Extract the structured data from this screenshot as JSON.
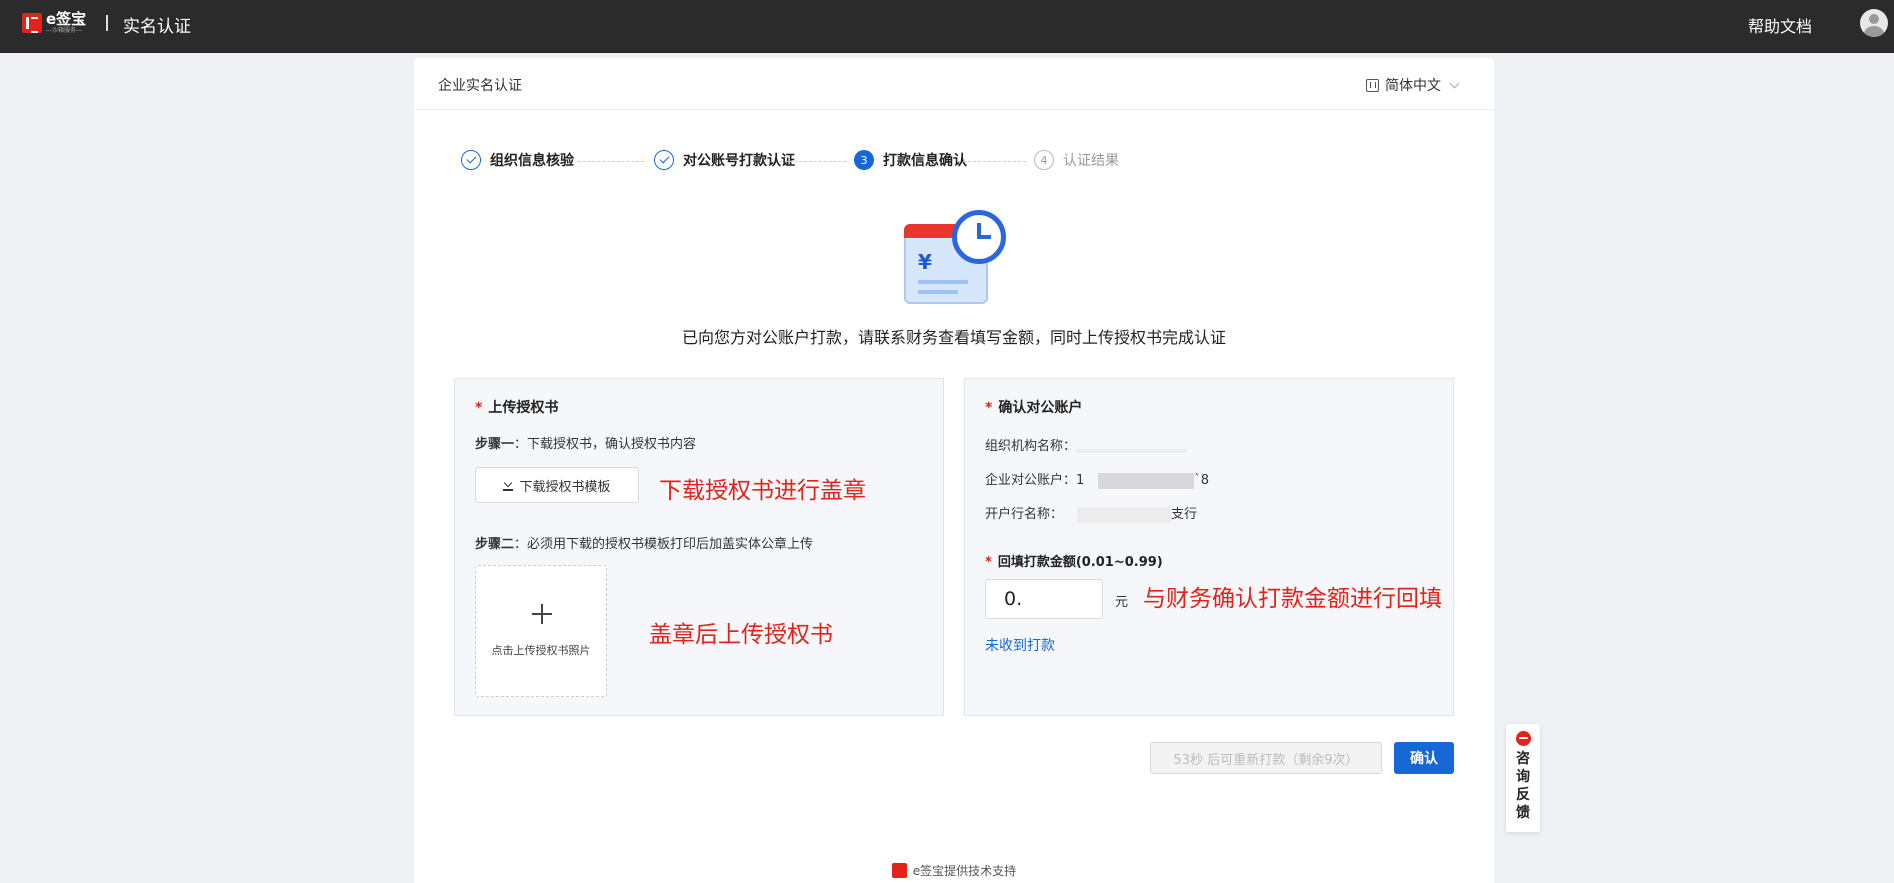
{
  "header": {
    "logo_name": "e签宝",
    "logo_sub": "—沙箱服务—",
    "title": "实名认证",
    "help_label": "帮助文档"
  },
  "card": {
    "title": "企业实名认证",
    "language": "简体中文"
  },
  "steps": [
    {
      "label": "组织信息核验",
      "status": "done"
    },
    {
      "label": "对公账号打款认证",
      "status": "done"
    },
    {
      "label": "打款信息确认",
      "status": "active",
      "number": "3"
    },
    {
      "label": "认证结果",
      "status": "pending",
      "number": "4"
    }
  ],
  "message": "已向您方对公账户打款，请联系财务查看填写金额，同时上传授权书完成认证",
  "left_panel": {
    "title": "上传授权书",
    "step1_label": "步骤一",
    "step1_text": "：下载授权书，确认授权书内容",
    "download_button": "下载授权书模板",
    "step2_label": "步骤二",
    "step2_text": "：必须用下载的授权书模板打印后加盖实体公章上传",
    "upload_text": "点击上传授权书照片",
    "annotation_download": "下载授权书进行盖章",
    "annotation_upload": "盖章后上传授权书"
  },
  "right_panel": {
    "title": "确认对公账户",
    "org_name_label": "组织机构名称：",
    "account_label": "企业对公账户：",
    "account_prefix": "1",
    "account_suffix": "`8",
    "bank_label": "开户行名称：",
    "bank_suffix": "支行",
    "amount_label": "回填打款金额(0.01~0.99)",
    "amount_value": "0.",
    "unit": "元",
    "not_received": "未收到打款",
    "annotation_amount": "与财务确认打款金额进行回填"
  },
  "actions": {
    "resend_label": "53秒 后可重新打款（剩余9次）",
    "confirm_label": "确认"
  },
  "footer": {
    "text": "e签宝提供技术支持"
  },
  "consult": {
    "label": "咨询反馈"
  },
  "colors": {
    "primary": "#1767d6",
    "brand_red": "#e2231a",
    "topbar": "#2b2b2b"
  },
  "icons": [
    "logo-icon",
    "avatar-icon",
    "language-icon",
    "chevron-down-icon",
    "check-icon",
    "download-icon",
    "plus-icon",
    "payment-clock-illustration",
    "chat-icon"
  ]
}
